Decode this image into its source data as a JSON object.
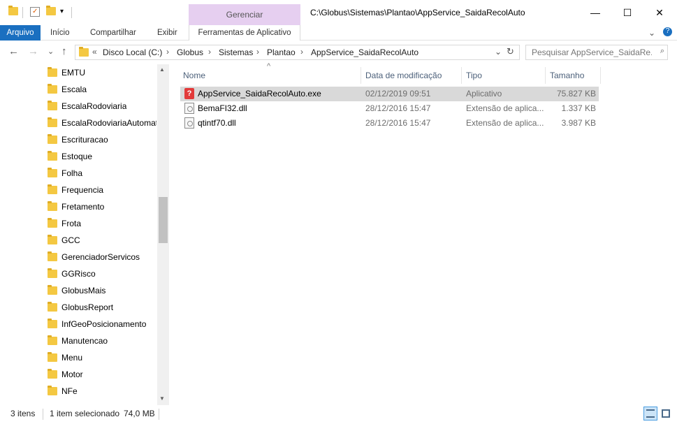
{
  "window": {
    "title": "C:\\Globus\\Sistemas\\Plantao\\AppService_SaidaRecolAuto",
    "context_group": "Gerenciar",
    "controls": {
      "minimize": "—",
      "maximize": "☐",
      "close": "✕"
    }
  },
  "ribbon": {
    "tabs": [
      "Arquivo",
      "Início",
      "Compartilhar",
      "Exibir",
      "Ferramentas de Aplicativo"
    ],
    "expand_icon": "chevron-down",
    "help_icon": "?"
  },
  "nav": {
    "back": "←",
    "forward": "→",
    "recent": "⌄",
    "up": "↑",
    "breadcrumb_prefix": "«",
    "breadcrumbs": [
      "Disco Local (C:)",
      "Globus",
      "Sistemas",
      "Plantao",
      "AppService_SaidaRecolAuto"
    ],
    "crumb_separator": "›",
    "dropdown": "⌄",
    "refresh": "↻",
    "search_placeholder": "Pesquisar AppService_SaidaRe...",
    "search_icon": "🔍"
  },
  "navpane": {
    "folders": [
      "EMTU",
      "Escala",
      "EscalaRodoviaria",
      "EscalaRodoviariaAutomati",
      "Escrituracao",
      "Estoque",
      "Folha",
      "Frequencia",
      "Fretamento",
      "Frota",
      "GCC",
      "GerenciadorServicos",
      "GGRisco",
      "GlobusMais",
      "GlobusReport",
      "InfGeoPosicionamento",
      "Manutencao",
      "Menu",
      "Motor",
      "NFe"
    ],
    "scroll_up": "▲",
    "scroll_down": "▼"
  },
  "filelist": {
    "columns": [
      "Nome",
      "Data de modificação",
      "Tipo",
      "Tamanho"
    ],
    "sort_indicator": "^",
    "files": [
      {
        "name": "AppService_SaidaRecolAuto.exe",
        "modified": "02/12/2019 09:51",
        "type": "Aplicativo",
        "size": "75.827 KB",
        "icon": "exe-icon",
        "selected": true
      },
      {
        "name": "BemaFI32.dll",
        "modified": "28/12/2016 15:47",
        "type": "Extensão de aplica...",
        "size": "1.337 KB",
        "icon": "dll-icon",
        "selected": false
      },
      {
        "name": "qtintf70.dll",
        "modified": "28/12/2016 15:47",
        "type": "Extensão de aplica...",
        "size": "3.987 KB",
        "icon": "dll-icon",
        "selected": false
      }
    ]
  },
  "status": {
    "item_count": "3 itens",
    "selection": "1 item selecionado",
    "selection_size": "74,0 MB"
  },
  "colors": {
    "accent": "#1a6fc0",
    "context_tab": "#e6cff0",
    "selection": "#d9d9d9"
  }
}
